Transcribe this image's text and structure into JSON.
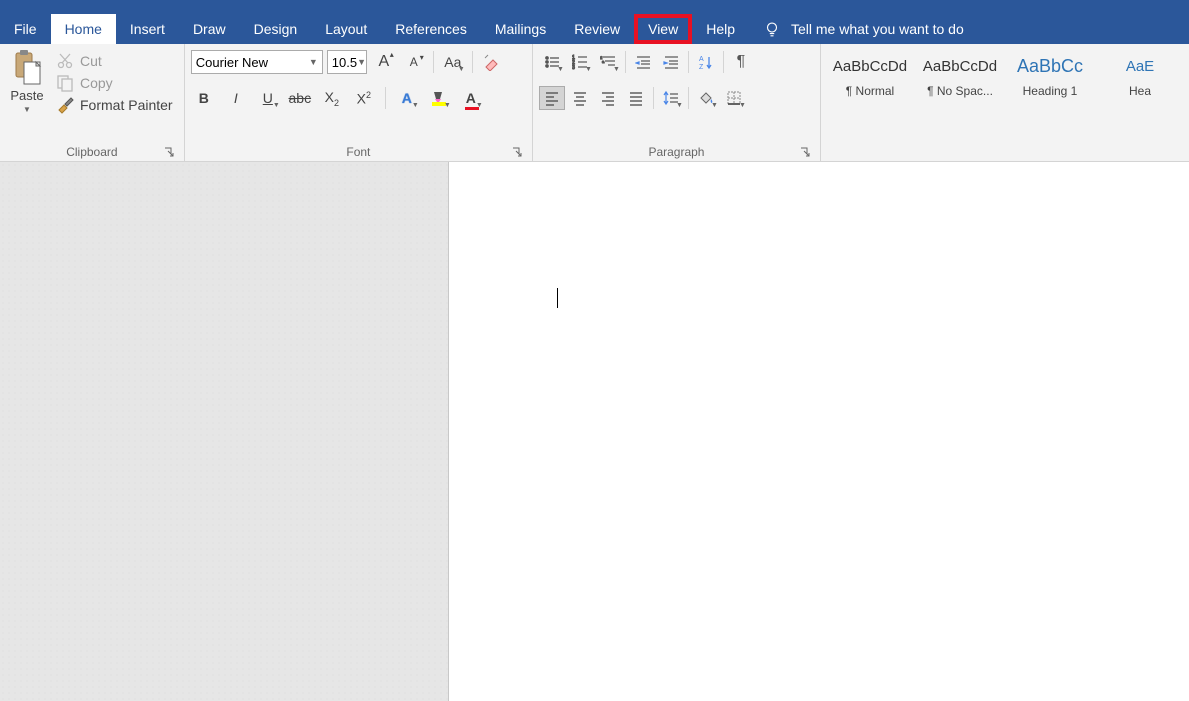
{
  "tabs": {
    "file": "File",
    "home": "Home",
    "insert": "Insert",
    "draw": "Draw",
    "design": "Design",
    "layout": "Layout",
    "references": "References",
    "mailings": "Mailings",
    "review": "Review",
    "view": "View",
    "help": "Help",
    "tell_me": "Tell me what you want to do"
  },
  "clipboard": {
    "paste": "Paste",
    "cut": "Cut",
    "copy": "Copy",
    "format_painter": "Format Painter",
    "label": "Clipboard"
  },
  "font": {
    "name": "Courier New",
    "size": "10.5",
    "label": "Font"
  },
  "paragraph": {
    "label": "Paragraph"
  },
  "styles": {
    "items": [
      {
        "preview": "AaBbCcDd",
        "name": "¶ Normal",
        "cls": ""
      },
      {
        "preview": "AaBbCcDd",
        "name": "¶ No Spac...",
        "cls": ""
      },
      {
        "preview": "AaBbCc",
        "name": "Heading 1",
        "cls": "heading1"
      },
      {
        "preview": "AaE",
        "name": "Hea",
        "cls": "heading2"
      }
    ]
  }
}
